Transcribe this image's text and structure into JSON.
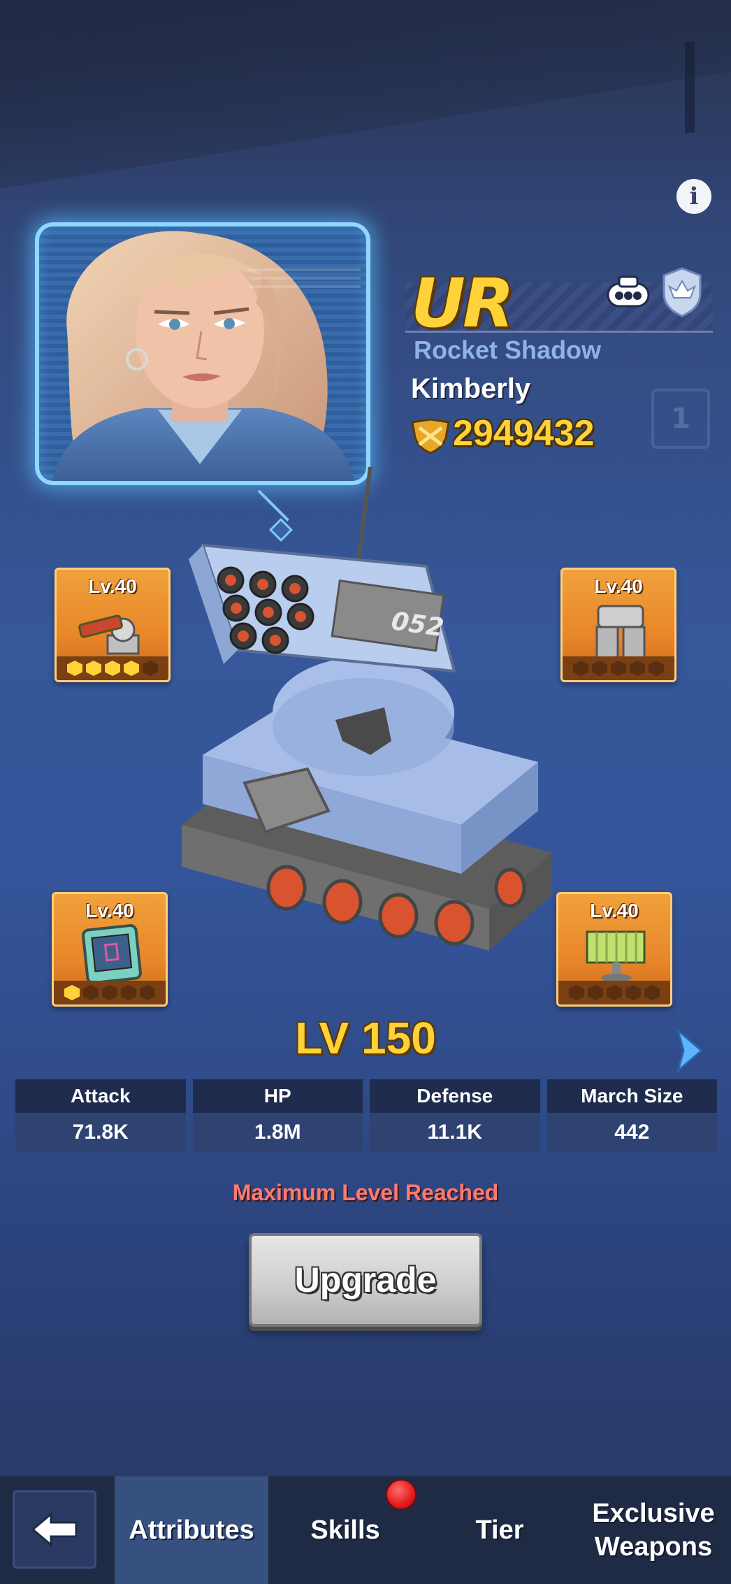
{
  "hero": {
    "rarity": "UR",
    "class": "Rocket Shadow",
    "name": "Kimberly",
    "power": "2949432",
    "level": "LV 150"
  },
  "icons": {
    "info": "info-icon",
    "tank_badge": "tank-type-icon",
    "shield_badge": "shield-icon",
    "power": "power-icon",
    "next": "chevron-right-icon",
    "back": "arrow-left-icon"
  },
  "equipment": [
    {
      "slot": "weapon",
      "level": "Lv.40",
      "stars_on": 4,
      "stars_total": 5
    },
    {
      "slot": "armor",
      "level": "Lv.40",
      "stars_on": 0,
      "stars_total": 5
    },
    {
      "slot": "chip",
      "level": "Lv.40",
      "stars_on": 1,
      "stars_total": 5
    },
    {
      "slot": "radar",
      "level": "Lv.40",
      "stars_on": 0,
      "stars_total": 5
    }
  ],
  "stats": [
    {
      "label": "Attack",
      "value": "71.8K"
    },
    {
      "label": "HP",
      "value": "1.8M"
    },
    {
      "label": "Defense",
      "value": "11.1K"
    },
    {
      "label": "March Size",
      "value": "442"
    }
  ],
  "status_text": "Maximum Level Reached",
  "upgrade_label": "Upgrade",
  "tabs": [
    {
      "label": "Attributes",
      "active": true
    },
    {
      "label": "Skills",
      "active": false,
      "notification": true
    },
    {
      "label": "Tier",
      "active": false
    },
    {
      "label": "Exclusive Weapons",
      "active": false
    }
  ],
  "tank_number": "052",
  "colors": {
    "gold": "#ffd23a",
    "warning": "#ff7a6e",
    "equip_orange": "#e8862a",
    "nav_bg": "#1f2a45"
  }
}
